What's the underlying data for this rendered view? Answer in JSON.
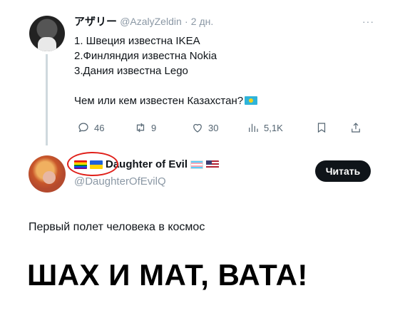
{
  "original_post": {
    "author_name": "アザリー",
    "handle": "@AzalyZeldin",
    "separator": "·",
    "time": "2 дн.",
    "more": "···",
    "lines": [
      "1. Швеция известна IKEA",
      "2.Финляндия известна  Nokia",
      "3.Дания известна Lego"
    ],
    "question": "Чем или кем известен Казахстан?",
    "actions": {
      "replies": "46",
      "reposts": "9",
      "likes": "30",
      "views": "5,1K"
    }
  },
  "reply_post": {
    "author_name": "Daughter of Evil",
    "handle": "@DaughterOfEvilQ",
    "follow_label": "Читать",
    "text": "Первый полет человека в космос"
  },
  "caption": "ШАХ И МАТ, ВАТА!",
  "colors": {
    "handle_gray": "#8b98a5",
    "icon_gray": "#536471",
    "button_bg": "#0f1419",
    "highlight_circle": "#e0201a",
    "kz_flag": "#2fb4d9"
  }
}
